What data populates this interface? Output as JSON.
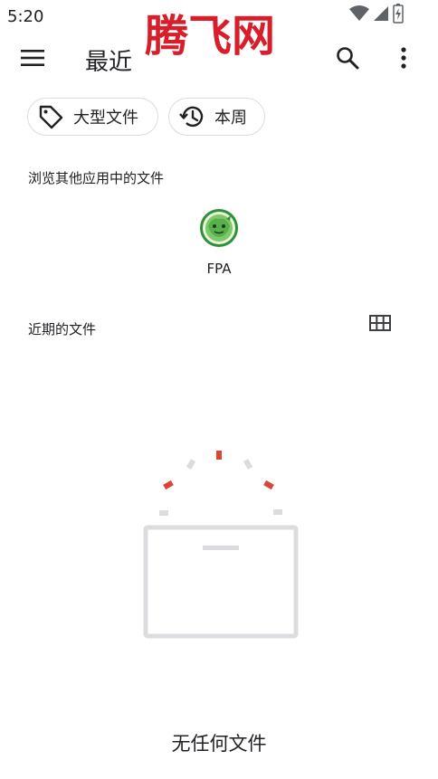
{
  "status_bar": {
    "time": "5:20",
    "icons": [
      "wifi-icon",
      "cell-signal-icon",
      "battery-charging-icon"
    ]
  },
  "watermark": "腾飞网",
  "app_bar": {
    "title": "最近",
    "menu_icon": "hamburger-menu-icon",
    "search_icon": "search-icon",
    "more_icon": "more-vert-icon"
  },
  "chips": [
    {
      "label": "大型文件",
      "icon": "tag-icon"
    },
    {
      "label": "本周",
      "icon": "history-icon"
    }
  ],
  "browse_section": {
    "label": "浏览其他应用中的文件",
    "apps": [
      {
        "name": "FPA",
        "icon": "fpa-app-icon"
      }
    ]
  },
  "recent_section": {
    "label": "近期的文件",
    "view_toggle_icon": "grid-view-icon"
  },
  "empty_state": {
    "text": "无任何文件",
    "illustration": "empty-tray-illustration",
    "colors": {
      "accent": "#db4437",
      "gray": "#dadce0"
    }
  }
}
